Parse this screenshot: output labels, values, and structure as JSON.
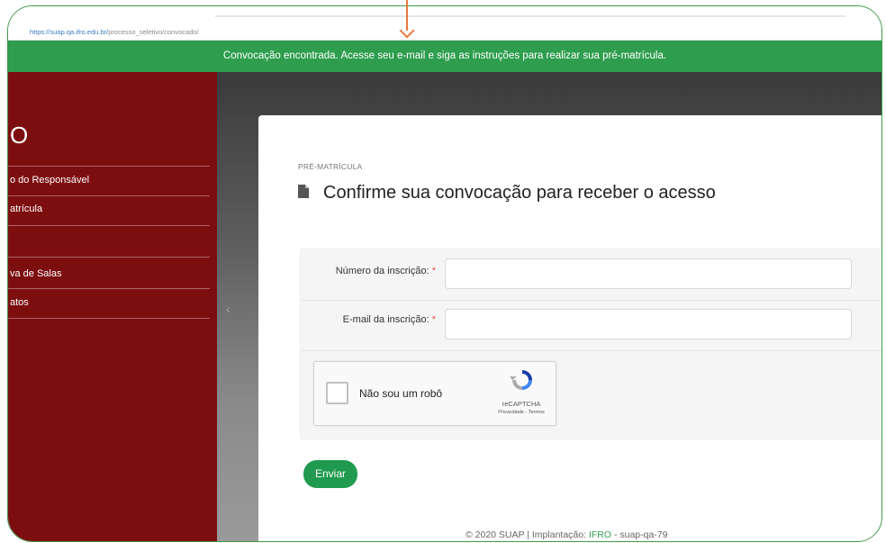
{
  "browser": {
    "url_host": "https://suap.qa.ifro.edu.br/",
    "url_path": "processo_seletivo/convocado/"
  },
  "notice": {
    "text": "Convocação encontrada. Acesse seu e-mail e siga as instruções para realizar sua pré-matrícula.",
    "color": "#2e9e4e"
  },
  "sidebar": {
    "logo_letter": "O",
    "color": "#7d0e10",
    "items": [
      {
        "label": "o do Responsável"
      },
      {
        "label": "atrícula"
      },
      {
        "label": "va de Salas"
      },
      {
        "label": "atos"
      }
    ]
  },
  "card": {
    "eyebrow": "PRÉ-MATRÍCULA",
    "title_icon": "document-icon",
    "title": "Confirme sua convocação para receber o acesso"
  },
  "form": {
    "fields": [
      {
        "label": "Número da inscrição:",
        "required_mark": "*",
        "value": ""
      },
      {
        "label": "E-mail da inscrição:",
        "required_mark": "*",
        "value": ""
      }
    ],
    "recaptcha": {
      "label": "Não sou um robô",
      "brand": "reCAPTCHA",
      "links": "Privacidade - Termos",
      "checked": false
    },
    "submit_label": "Enviar",
    "submit_color": "#1f9a4e"
  },
  "footer": {
    "prefix": "© 2020 SUAP | Implantação: ",
    "highlight": "IFRO",
    "suffix": " - suap-qa-79"
  }
}
